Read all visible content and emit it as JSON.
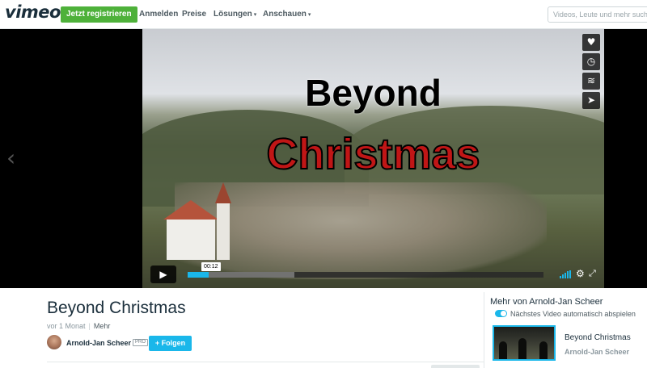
{
  "header": {
    "logo": "vimeo",
    "join_button": "Jetzt registrieren",
    "nav": {
      "login": "Anmelden",
      "pricing": "Preise",
      "solutions": "Lösungen",
      "watch": "Anschauen"
    },
    "search_placeholder": "Videos, Leute und mehr suchen"
  },
  "player": {
    "overlay_title_line1": "Beyond",
    "overlay_title_line2": "Christmas",
    "time_tooltip": "00:12",
    "progress": 0.06,
    "buffered": 0.3,
    "side_buttons": [
      "heart-icon",
      "clock-icon",
      "layers-icon",
      "send-icon"
    ],
    "icons": {
      "play": "▶",
      "settings": "⚙",
      "fullscreen": "⤢",
      "prev": "‹"
    }
  },
  "video": {
    "title": "Beyond Christmas",
    "age": "vor 1 Monat",
    "more_link": "Mehr",
    "author": "Arnold-Jan Scheer",
    "badge": "PRO",
    "follow_button": "+ Folgen"
  },
  "sidebar": {
    "heading": "Mehr von Arnold-Jan Scheer",
    "autoplay_label": "Nächstes Video automatisch abspielen",
    "autoplay_on": true,
    "related": [
      {
        "title": "Beyond Christmas",
        "author": "Arnold-Jan Scheer"
      }
    ]
  },
  "colors": {
    "accent": "#1ab7ea",
    "join_green": "#4eb13a",
    "title_red": "#c01616"
  }
}
